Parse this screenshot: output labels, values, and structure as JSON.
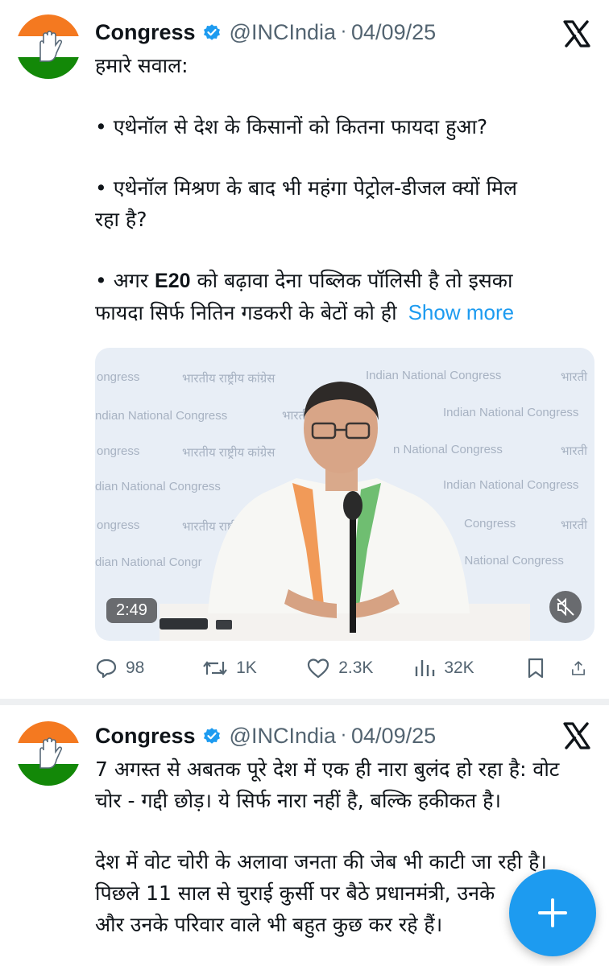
{
  "tweet1": {
    "name": "Congress",
    "handle": "@INCIndia",
    "separator": "·",
    "date": "04/09/25",
    "paragraphs": {
      "p1": "हमारे सवाल:",
      "p2": "• एथेनॉल से देश के किसानों को कितना फायदा हुआ?",
      "p3a": "• एथेनॉल मिश्रण के बाद भी महंगा पेट्रोल-डीजल क्यों मिल",
      "p3b": "रहा है?",
      "p4_pre": "• अगर ",
      "p4_bold": "E20",
      "p4_post": " को बढ़ावा देना पब्लिक पॉलिसी है तो इसका",
      "p4b": "फायदा सिर्फ नितिन गडकरी के बेटों को ही"
    },
    "show_more": "Show more",
    "video": {
      "duration": "2:49",
      "watermarks": {
        "r1a": "ongress",
        "r1b": "भारतीय राष्ट्रीय कांग्रेस",
        "r1c": "Indian National Congress",
        "r1d": "भारती",
        "r2a": "ndian National Congress",
        "r2b": "भारती",
        "r2c": "Indian National Congress",
        "r3a": "ongress",
        "r3b": "भारतीय राष्ट्रीय कांग्रेस",
        "r3c": "n National Congress",
        "r3d": "भारती",
        "r4a": "dian National Congress",
        "r4b": "Indian National Congress",
        "r5a": "ongress",
        "r5b": "भारतीय राष्ट्री",
        "r5c": "Congress",
        "r5d": "भारती",
        "r6a": "dian National Congr",
        "r6b": "n National Congress"
      }
    },
    "stats": {
      "replies": "98",
      "reposts": "1K",
      "likes": "2.3K",
      "views": "32K"
    }
  },
  "tweet2": {
    "name": "Congress",
    "handle": "@INCIndia",
    "separator": "·",
    "date": "04/09/25",
    "lines": {
      "l1": "7 अगस्त से अबतक पूरे देश में एक ही नारा बुलंद हो रहा है: वोट",
      "l2": "चोर - गद्दी छोड़। ये सिर्फ नारा नहीं है, बल्कि हकीकत है।",
      "l3": "देश में वोट चोरी के अलावा जनता की जेब भी काटी जा रही है।",
      "l4": "पिछले 11 साल से चुराई कुर्सी पर बैठे प्रधानमंत्री, उनके",
      "l5": "और उनके परिवार वाले भी बहुत कुछ कर रहे हैं।"
    }
  },
  "colors": {
    "accent": "#1d9bf0",
    "muted": "#536471",
    "saffron": "#f47920",
    "green": "#138808"
  },
  "icons": [
    "verified-badge-icon",
    "x-logo-icon",
    "reply-icon",
    "repost-icon",
    "like-icon",
    "views-icon",
    "bookmark-icon",
    "share-icon",
    "mute-icon",
    "compose-icon"
  ]
}
